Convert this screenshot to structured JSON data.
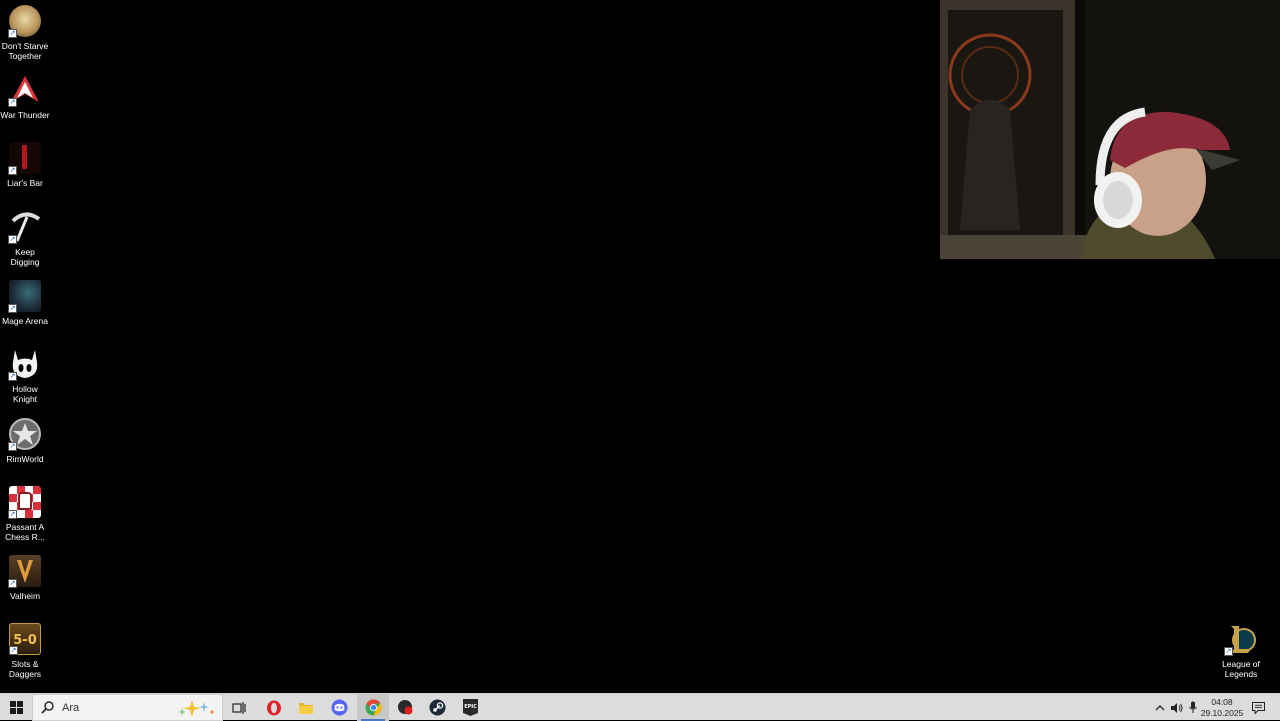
{
  "desktop": {
    "icons": [
      {
        "label": "Don't Starve Together",
        "icon": "dont-starve-together-icon",
        "color": "#c9b07a"
      },
      {
        "label": "War Thunder",
        "icon": "war-thunder-icon",
        "color": "#c23a3a"
      },
      {
        "label": "Liar's Bar",
        "icon": "liars-bar-icon",
        "color": "#8a1c1c"
      },
      {
        "label": "Keep Digging",
        "icon": "keep-digging-icon",
        "color": "#cccccc"
      },
      {
        "label": "Mage Arena",
        "icon": "mage-arena-icon",
        "color": "#2c3a4a"
      },
      {
        "label": "Hollow Knight",
        "icon": "hollow-knight-icon",
        "color": "#ffffff"
      },
      {
        "label": "RimWorld",
        "icon": "rimworld-icon",
        "color": "#9a9a9a"
      },
      {
        "label": "Passant A Chess R...",
        "icon": "passant-chess-icon",
        "color": "#d8313a"
      },
      {
        "label": "Valheim",
        "icon": "valheim-icon",
        "color": "#6b4a2a"
      },
      {
        "label": "Slots & Daggers",
        "icon": "slots-and-daggers-icon",
        "color": "#b58a3a"
      }
    ],
    "right_icon": {
      "label": "League of Legends",
      "icon": "league-of-legends-icon",
      "color": "#c8a24a"
    }
  },
  "taskbar": {
    "search_placeholder": "Ara",
    "apps": [
      {
        "name": "task-view",
        "icon": "task-view-icon"
      },
      {
        "name": "opera",
        "icon": "opera-icon",
        "color": "#e0202a"
      },
      {
        "name": "file-explorer",
        "icon": "folder-icon",
        "color": "#e8b422"
      },
      {
        "name": "discord",
        "icon": "discord-icon",
        "color": "#5865f2"
      },
      {
        "name": "chrome",
        "icon": "chrome-icon",
        "color": "#34a853"
      },
      {
        "name": "app-record",
        "icon": "record-app-icon",
        "color": "#2a2a2a"
      },
      {
        "name": "steam",
        "icon": "steam-icon",
        "color": "#1b2838"
      },
      {
        "name": "epic-games",
        "icon": "epic-games-icon",
        "color": "#2a2a2a"
      }
    ],
    "clock": {
      "time": "04:08",
      "date": "29.10.2025"
    }
  }
}
